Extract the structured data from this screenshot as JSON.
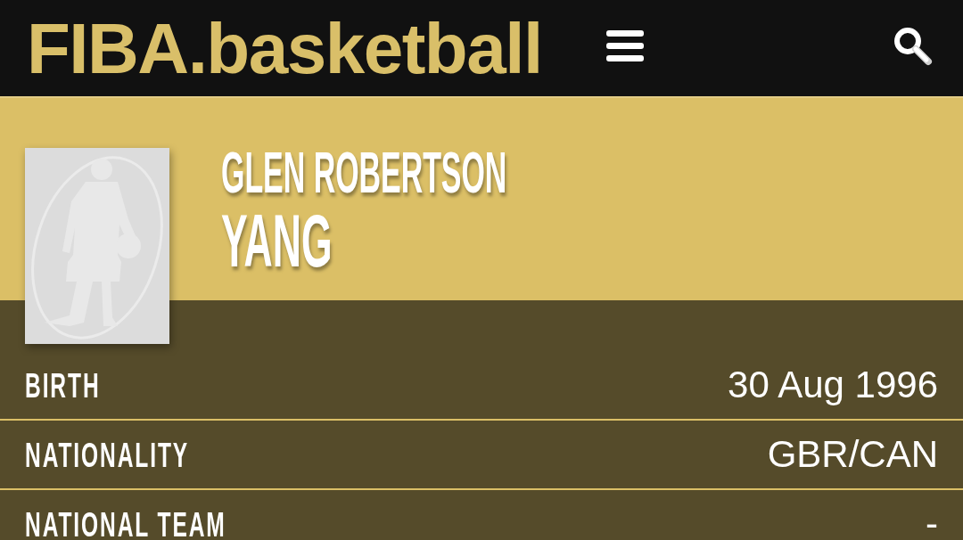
{
  "header": {
    "logo": "FIBA.basketball"
  },
  "player": {
    "first_names": "GLEN ROBERTSON",
    "last_name": "YANG"
  },
  "details": [
    {
      "label": "BIRTH",
      "value": "30 Aug 1996"
    },
    {
      "label": "NATIONALITY",
      "value": "GBR/CAN"
    },
    {
      "label": "NATIONAL TEAM",
      "value": "-"
    }
  ]
}
